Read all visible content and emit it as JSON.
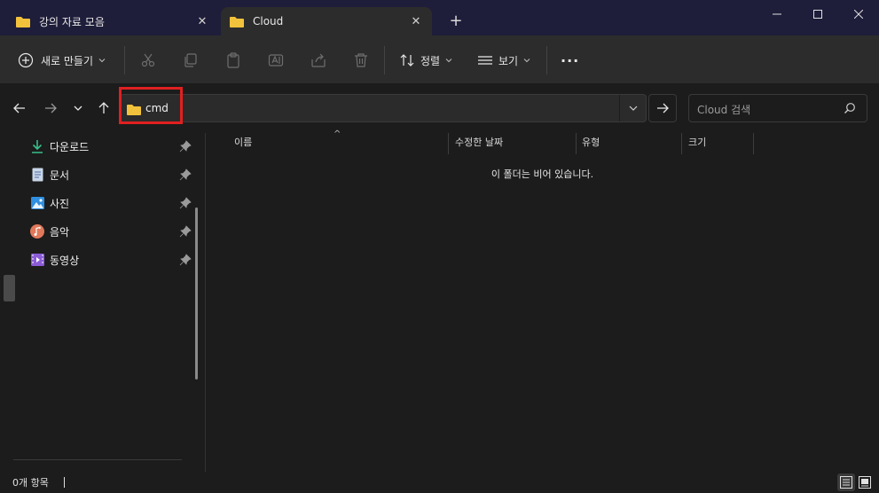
{
  "tabs": [
    {
      "label": "강의 자료 모음",
      "close": "✕"
    },
    {
      "label": "Cloud",
      "close": "✕"
    }
  ],
  "new_tab": "+",
  "window": {
    "minimize": "minimize-icon",
    "maximize": "maximize-icon",
    "close": "close-icon"
  },
  "toolbar": {
    "new_label": "새로 만들기",
    "sort_label": "정렬",
    "view_label": "보기",
    "more": "···"
  },
  "address": {
    "path": "cmd",
    "search_placeholder": "Cloud 검색"
  },
  "sidebar": {
    "items": [
      {
        "label": "다운로드",
        "icon": "download-icon"
      },
      {
        "label": "문서",
        "icon": "document-icon"
      },
      {
        "label": "사진",
        "icon": "picture-icon"
      },
      {
        "label": "음악",
        "icon": "music-icon"
      },
      {
        "label": "동영상",
        "icon": "video-icon"
      }
    ]
  },
  "columns": {
    "name": "이름",
    "modified": "수정한 날짜",
    "type": "유형",
    "size": "크기"
  },
  "content": {
    "empty_message": "이 폴더는 비어 있습니다."
  },
  "status": {
    "item_count": "0개 항목"
  },
  "colors": {
    "accent_red": "#e02020",
    "folder": "#f3c23c",
    "titlebar": "#1e1d3a"
  }
}
